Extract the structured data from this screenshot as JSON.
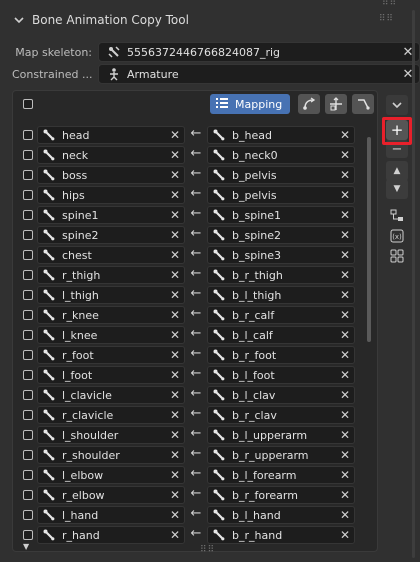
{
  "panel": {
    "title": "Bone Animation Copy Tool",
    "map_skeleton": {
      "label": "Map skeleton:",
      "value": "5556372446766824087_rig",
      "icon": "armature-icon"
    },
    "constrained": {
      "label": "Constrained ...",
      "value": "Armature",
      "icon": "armature-icon"
    }
  },
  "toolbar": {
    "mapping_label": "Mapping",
    "tools": [
      "pose-icon",
      "transform-icon",
      "hook-icon"
    ]
  },
  "rows": [
    {
      "source": "head",
      "target": "b_head"
    },
    {
      "source": "neck",
      "target": "b_neck0"
    },
    {
      "source": "boss",
      "target": "b_pelvis"
    },
    {
      "source": "hips",
      "target": "b_pelvis"
    },
    {
      "source": "spine1",
      "target": "b_spine1"
    },
    {
      "source": "spine2",
      "target": "b_spine2"
    },
    {
      "source": "chest",
      "target": "b_spine3"
    },
    {
      "source": "r_thigh",
      "target": "b_r_thigh"
    },
    {
      "source": "l_thigh",
      "target": "b_l_thigh"
    },
    {
      "source": "r_knee",
      "target": "b_r_calf"
    },
    {
      "source": "l_knee",
      "target": "b_l_calf"
    },
    {
      "source": "r_foot",
      "target": "b_r_foot"
    },
    {
      "source": "l_foot",
      "target": "b_l_foot"
    },
    {
      "source": "l_clavicle",
      "target": "b_l_clav"
    },
    {
      "source": "r_clavicle",
      "target": "b_r_clav"
    },
    {
      "source": "l_shoulder",
      "target": "b_l_upperarm"
    },
    {
      "source": "r_shoulder",
      "target": "b_r_upperarm"
    },
    {
      "source": "l_elbow",
      "target": "b_l_forearm"
    },
    {
      "source": "r_elbow",
      "target": "b_r_forearm"
    },
    {
      "source": "l_hand",
      "target": "b_l_hand"
    },
    {
      "source": "r_hand",
      "target": "b_r_hand"
    }
  ],
  "side_buttons": {
    "add": "+",
    "remove": "−",
    "move_up": "▲",
    "move_down": "▼"
  },
  "highlight_color": "#e8202b",
  "accent_color": "#4772b3"
}
